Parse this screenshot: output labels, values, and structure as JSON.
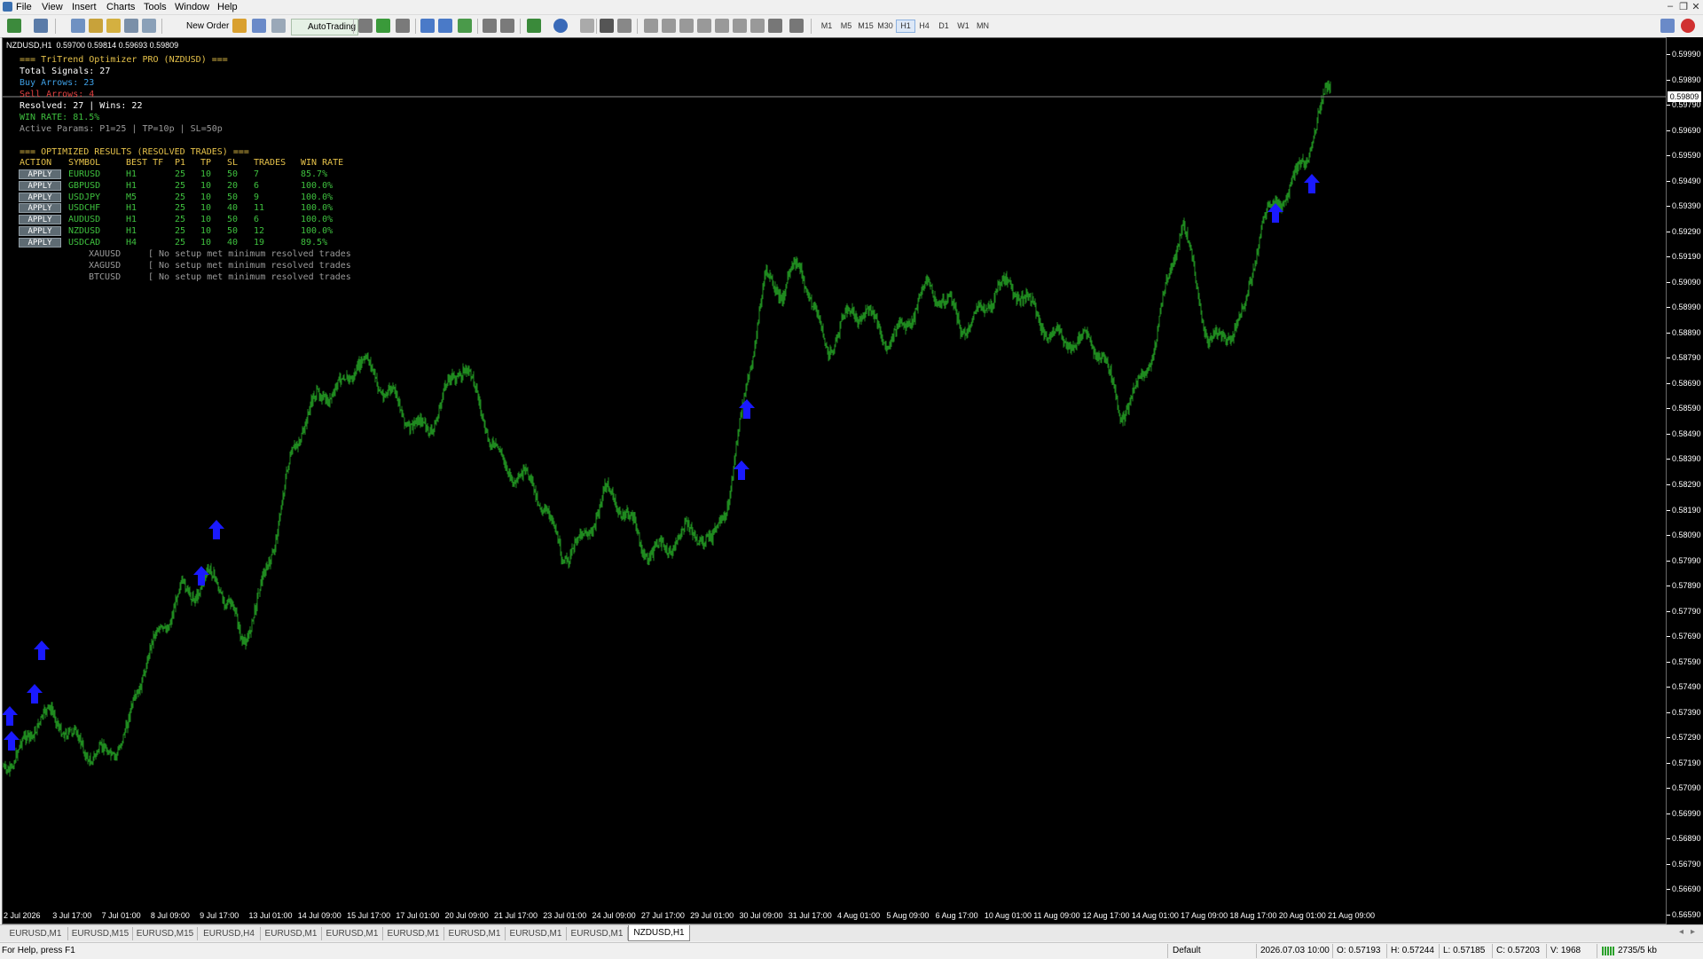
{
  "menu": [
    "File",
    "View",
    "Insert",
    "Charts",
    "Tools",
    "Window",
    "Help"
  ],
  "toolbar": {
    "new_order": "New Order",
    "autotrading": "AutoTrading",
    "timeframes": [
      "M1",
      "M5",
      "M15",
      "M30",
      "H1",
      "H4",
      "D1",
      "W1",
      "MN"
    ],
    "active_timeframe": "H1"
  },
  "chart": {
    "info_line": "NZDUSD,H1  0.59700 0.59814 0.59693 0.59809",
    "current_price": "0.59809",
    "colors": {
      "background": "#000000",
      "bars": "#1f8a1f",
      "arrows": "#1a1aff"
    }
  },
  "panel": {
    "header": "=== TriTrend Optimizer PRO (NZDUSD) ===",
    "total_signals": "Total Signals: 27",
    "buy_arrows": "Buy Arrows: 23",
    "sell_arrows": "Sell Arrows: 4",
    "resolved": "Resolved: 27 | Wins: 22",
    "win_rate": "WIN RATE: 81.5%",
    "active_params": "Active Params: P1=25 | TP=10p | SL=50p",
    "results_header": "=== OPTIMIZED RESULTS (RESOLVED TRADES) ===",
    "columns": [
      "ACTION",
      "SYMBOL",
      "BEST TF",
      "P1",
      "TP",
      "SL",
      "TRADES",
      "WIN RATE"
    ],
    "rows": [
      {
        "action": "APPLY",
        "symbol": "EURUSD",
        "tf": "H1",
        "p1": "25",
        "tp": "10",
        "sl": "50",
        "trades": "7",
        "wr": "85.7%"
      },
      {
        "action": "APPLY",
        "symbol": "GBPUSD",
        "tf": "H1",
        "p1": "25",
        "tp": "10",
        "sl": "20",
        "trades": "6",
        "wr": "100.0%"
      },
      {
        "action": "APPLY",
        "symbol": "USDJPY",
        "tf": "M5",
        "p1": "25",
        "tp": "10",
        "sl": "50",
        "trades": "9",
        "wr": "100.0%"
      },
      {
        "action": "APPLY",
        "symbol": "USDCHF",
        "tf": "H1",
        "p1": "25",
        "tp": "10",
        "sl": "40",
        "trades": "11",
        "wr": "100.0%"
      },
      {
        "action": "APPLY",
        "symbol": "AUDUSD",
        "tf": "H1",
        "p1": "25",
        "tp": "10",
        "sl": "50",
        "trades": "6",
        "wr": "100.0%"
      },
      {
        "action": "APPLY",
        "symbol": "NZDUSD",
        "tf": "H1",
        "p1": "25",
        "tp": "10",
        "sl": "50",
        "trades": "12",
        "wr": "100.0%"
      },
      {
        "action": "APPLY",
        "symbol": "USDCAD",
        "tf": "H4",
        "p1": "25",
        "tp": "10",
        "sl": "40",
        "trades": "19",
        "wr": "89.5%"
      }
    ],
    "no_setup": [
      {
        "symbol": "XAUUSD",
        "msg": "[ No setup met minimum resolved trades"
      },
      {
        "symbol": "XAGUSD",
        "msg": "[ No setup met minimum resolved trades"
      },
      {
        "symbol": "BTCUSD",
        "msg": "[ No setup met minimum resolved trades"
      }
    ]
  },
  "price_axis": [
    "0.59990",
    "0.59890",
    "0.59790",
    "0.59690",
    "0.59590",
    "0.59490",
    "0.59390",
    "0.59290",
    "0.59190",
    "0.59090",
    "0.58990",
    "0.58890",
    "0.58790",
    "0.58690",
    "0.58590",
    "0.58490",
    "0.58390",
    "0.58290",
    "0.58190",
    "0.58090",
    "0.57990",
    "0.57890",
    "0.57790",
    "0.57690",
    "0.57590",
    "0.57490",
    "0.57390",
    "0.57290",
    "0.57190",
    "0.57090",
    "0.56990",
    "0.56890",
    "0.56790",
    "0.56690",
    "0.56590"
  ],
  "time_axis": [
    "2 Jul 2026",
    "3 Jul 17:00",
    "7 Jul 01:00",
    "8 Jul 09:00",
    "9 Jul 17:00",
    "13 Jul 01:00",
    "14 Jul 09:00",
    "15 Jul 17:00",
    "17 Jul 01:00",
    "20 Jul 09:00",
    "21 Jul 17:00",
    "23 Jul 01:00",
    "24 Jul 09:00",
    "27 Jul 17:00",
    "29 Jul 01:00",
    "30 Jul 09:00",
    "31 Jul 17:00",
    "4 Aug 01:00",
    "5 Aug 09:00",
    "6 Aug 17:00",
    "10 Aug 01:00",
    "11 Aug 09:00",
    "12 Aug 17:00",
    "14 Aug 01:00",
    "17 Aug 09:00",
    "18 Aug 17:00",
    "20 Aug 01:00",
    "21 Aug 09:00"
  ],
  "tabs": [
    "EURUSD,M1",
    "EURUSD,M15",
    "EURUSD,M15",
    "EURUSD,H4",
    "EURUSD,M1",
    "EURUSD,M1",
    "EURUSD,M1",
    "EURUSD,M1",
    "EURUSD,M1",
    "EURUSD,M1",
    "NZDUSD,H1"
  ],
  "status": {
    "help": "For Help, press F1",
    "profile": "Default",
    "datetime": "2026.07.03 10:00",
    "open": "O: 0.57193",
    "high": "H: 0.57244",
    "low": "L: 0.57185",
    "close": "C: 0.57203",
    "volume": "V: 1968",
    "traffic": "2735/5 kb"
  }
}
